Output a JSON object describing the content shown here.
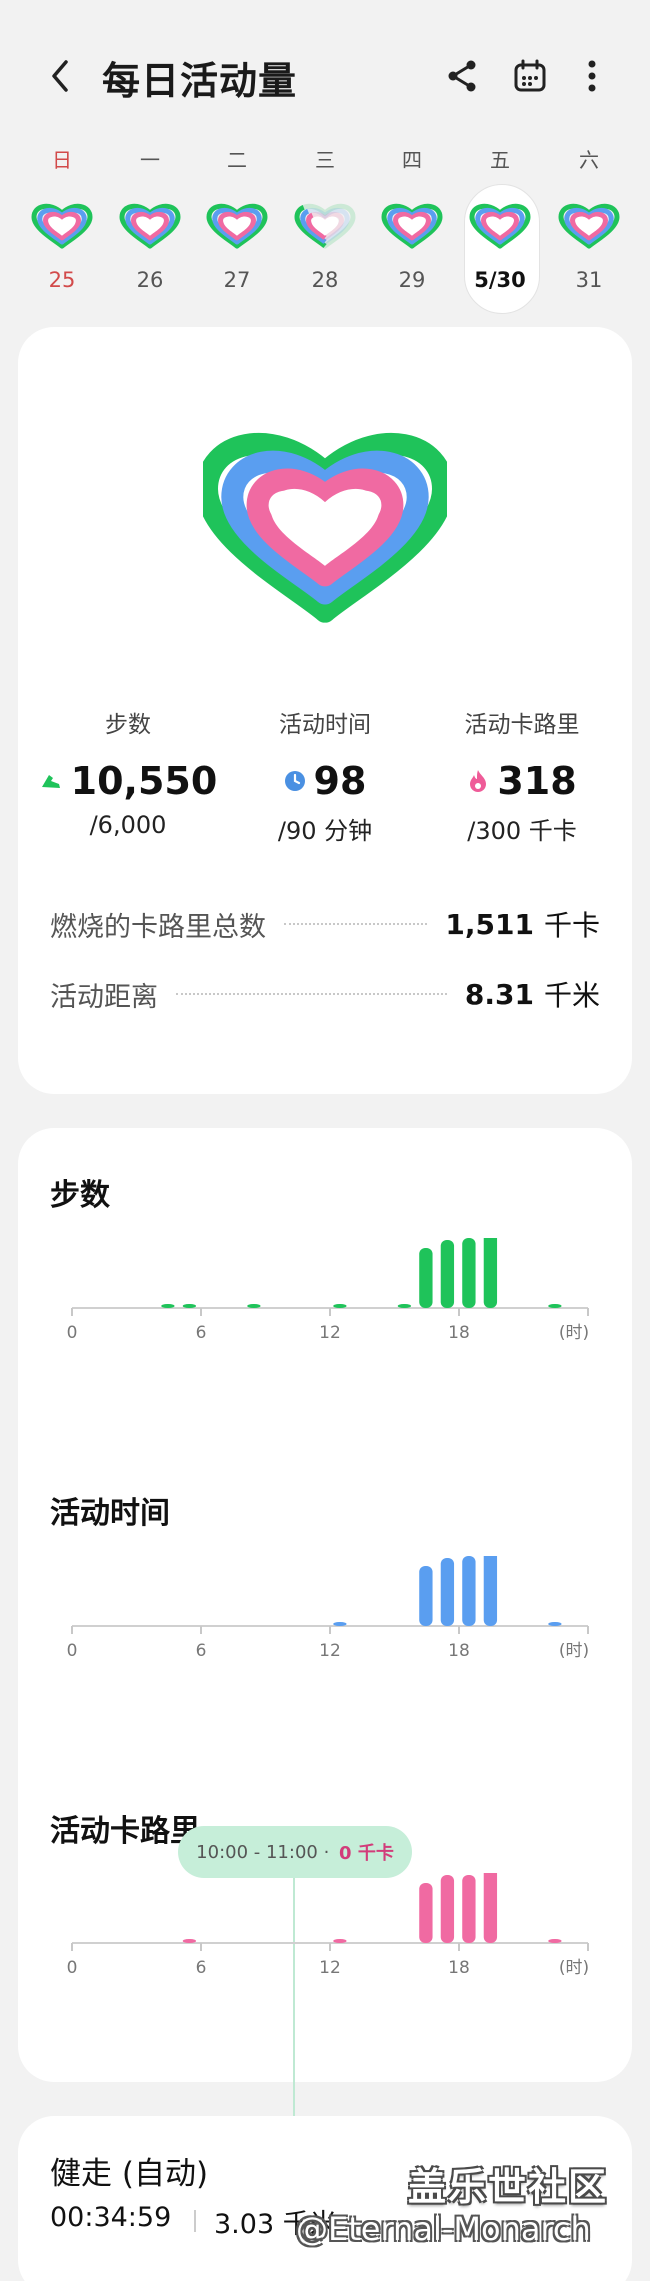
{
  "header": {
    "title": "每日活动量",
    "back_icon": "chevron-left-icon",
    "share_icon": "share-icon",
    "calendar_icon": "calendar-icon",
    "more_icon": "more-vertical-icon"
  },
  "week": [
    {
      "label": "日",
      "date": "25",
      "sunday": true,
      "progress": 1.0
    },
    {
      "label": "一",
      "date": "26",
      "progress": 1.0
    },
    {
      "label": "二",
      "date": "27",
      "progress": 1.0
    },
    {
      "label": "三",
      "date": "28",
      "progress": 0.35
    },
    {
      "label": "四",
      "date": "29",
      "progress": 1.0
    },
    {
      "label": "五",
      "date": "5/30",
      "selected": true,
      "progress": 1.0
    },
    {
      "label": "六",
      "date": "31",
      "progress": 1.0
    }
  ],
  "summary": {
    "stats": [
      {
        "label": "步数",
        "value": "10,550",
        "goal": "/6,000",
        "icon": "shoe-icon",
        "color": "#1fc35a"
      },
      {
        "label": "活动时间",
        "value": "98",
        "goal": "/90 分钟",
        "icon": "clock-icon",
        "color": "#4a90e2"
      },
      {
        "label": "活动卡路里",
        "value": "318",
        "goal": "/300 千卡",
        "icon": "flame-icon",
        "color": "#ef5b98"
      }
    ],
    "details": [
      {
        "label": "燃烧的卡路里总数",
        "value": "1,511",
        "unit": "千卡"
      },
      {
        "label": "活动距离",
        "value": "8.31",
        "unit": "千米"
      }
    ]
  },
  "colors": {
    "steps": "#1fc35a",
    "active_time": "#5a9ef0",
    "calories": "#f06aa2",
    "ring_outer": "#1fc35a",
    "ring_middle": "#5a9ef0",
    "ring_inner": "#f06aa2"
  },
  "chart_data": [
    {
      "type": "bar",
      "title": "步数",
      "x": [
        4,
        5,
        8,
        12,
        15,
        16,
        17,
        18,
        19,
        22
      ],
      "values": [
        0.03,
        0.03,
        0.03,
        0.03,
        0.03,
        0.6,
        0.68,
        0.7,
        1.0,
        0.03
      ],
      "xticks": [
        "0",
        "6",
        "12",
        "18",
        "(时)"
      ],
      "xlim": [
        0,
        24
      ]
    },
    {
      "type": "bar",
      "title": "活动时间",
      "x": [
        12,
        16,
        17,
        18,
        19,
        22
      ],
      "values": [
        0.03,
        0.6,
        0.68,
        0.7,
        1.0,
        0.03
      ],
      "xticks": [
        "0",
        "6",
        "12",
        "18",
        "(时)"
      ],
      "xlim": [
        0,
        24
      ]
    },
    {
      "type": "bar",
      "title": "活动卡路里",
      "x": [
        5,
        12,
        16,
        17,
        18,
        19,
        22
      ],
      "values": [
        0.03,
        0.03,
        0.6,
        0.68,
        0.68,
        1.0,
        0.03
      ],
      "xticks": [
        "0",
        "6",
        "12",
        "18",
        "(时)"
      ],
      "xlim": [
        0,
        24
      ],
      "tooltip": {
        "range": "10:00 - 11:00",
        "value": "0 千卡"
      }
    }
  ],
  "workout": {
    "title": "健走 (自动)",
    "duration": "00:34:59",
    "distance": "3.03 千米"
  },
  "watermark": {
    "main": "盖乐世社区",
    "sub": "@Eternal-Monarch"
  }
}
